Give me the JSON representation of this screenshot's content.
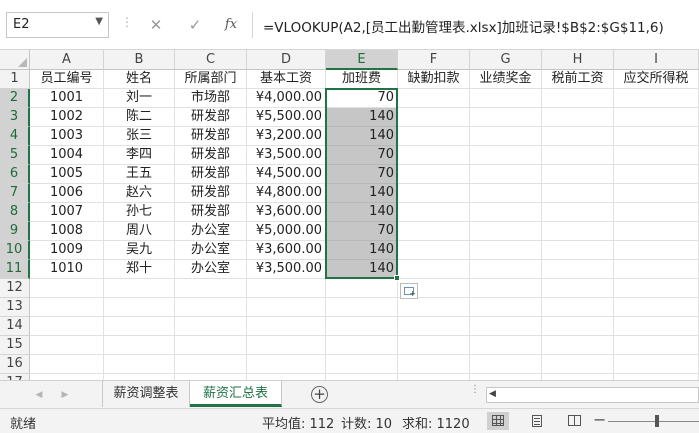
{
  "formula_bar": {
    "name_box": "E2",
    "cancel_icon": "✕",
    "enter_icon": "✓",
    "fx_label": "fx",
    "formula": "=VLOOKUP(A2,[员工出勤管理表.xlsx]加班记录!$B$2:$G$11,6)"
  },
  "columns": [
    "A",
    "B",
    "C",
    "D",
    "E",
    "F",
    "G",
    "H",
    "I"
  ],
  "row_numbers": [
    "1",
    "2",
    "3",
    "4",
    "5",
    "6",
    "7",
    "8",
    "9",
    "10",
    "11",
    "12",
    "13",
    "14",
    "15",
    "16",
    "17"
  ],
  "headers": [
    "员工编号",
    "姓名",
    "所属部门",
    "基本工资",
    "加班费",
    "缺勤扣款",
    "业绩奖金",
    "税前工资",
    "应交所得税"
  ],
  "rows": [
    [
      "1001",
      "刘一",
      "市场部",
      "¥4,000.00",
      "70"
    ],
    [
      "1002",
      "陈二",
      "研发部",
      "¥5,500.00",
      "140"
    ],
    [
      "1003",
      "张三",
      "研发部",
      "¥3,200.00",
      "140"
    ],
    [
      "1004",
      "李四",
      "研发部",
      "¥3,500.00",
      "70"
    ],
    [
      "1005",
      "王五",
      "研发部",
      "¥4,500.00",
      "70"
    ],
    [
      "1006",
      "赵六",
      "研发部",
      "¥4,800.00",
      "140"
    ],
    [
      "1007",
      "孙七",
      "研发部",
      "¥3,600.00",
      "140"
    ],
    [
      "1008",
      "周八",
      "办公室",
      "¥5,000.00",
      "70"
    ],
    [
      "1009",
      "吴九",
      "办公室",
      "¥3,600.00",
      "140"
    ],
    [
      "1010",
      "郑十",
      "办公室",
      "¥3,500.00",
      "140"
    ]
  ],
  "sheet_tabs": [
    "薪资调整表",
    "薪资汇总表"
  ],
  "active_sheet": "薪资汇总表",
  "add_sheet_label": "+",
  "status": {
    "ready": "就绪",
    "average": "平均值: 112",
    "count": "计数: 10",
    "sum": "求和: 1120"
  },
  "colors": {
    "accent": "#217346",
    "selection_fill": "#c6c6c6"
  }
}
